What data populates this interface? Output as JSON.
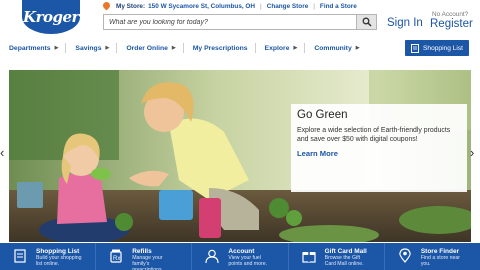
{
  "logo": {
    "text": "Kroger"
  },
  "store": {
    "label": "My Store:",
    "address": "150 W Sycamore St, Columbus, OH",
    "change_link": "Change Store",
    "find_link": "Find a Store"
  },
  "search": {
    "placeholder": "What are you looking for today?"
  },
  "account": {
    "signin": "Sign In",
    "no_account": "No Account?",
    "register": "Register"
  },
  "nav": {
    "items": [
      "Departments",
      "Savings",
      "Order Online",
      "My Prescriptions",
      "Explore",
      "Community"
    ],
    "shopping_list": "Shopping List"
  },
  "hero": {
    "title": "Go Green",
    "body": "Explore a wide selection of Earth-friendly products and save over $50 with digital coupons!",
    "link": "Learn More",
    "prev_arrow": "‹",
    "next_arrow": "›"
  },
  "bottom_bar": [
    {
      "icon": "shopping-list-icon",
      "title": "Shopping List",
      "desc1": "Build your shopping",
      "desc2": "list online."
    },
    {
      "icon": "prescription-icon",
      "title": "Refills",
      "desc1": "Manage your",
      "desc2": "family's",
      "desc3": "prescriptions"
    },
    {
      "icon": "account-icon",
      "title": "Account",
      "desc1": "View your fuel",
      "desc2": "points and more."
    },
    {
      "icon": "gift-card-icon",
      "title": "Gift Card Mall",
      "desc1": "Browse the Gift",
      "desc2": "Card Mall online."
    },
    {
      "icon": "store-finder-icon",
      "title": "Store Finder",
      "desc1": "Find a store near",
      "desc2": "you."
    }
  ]
}
